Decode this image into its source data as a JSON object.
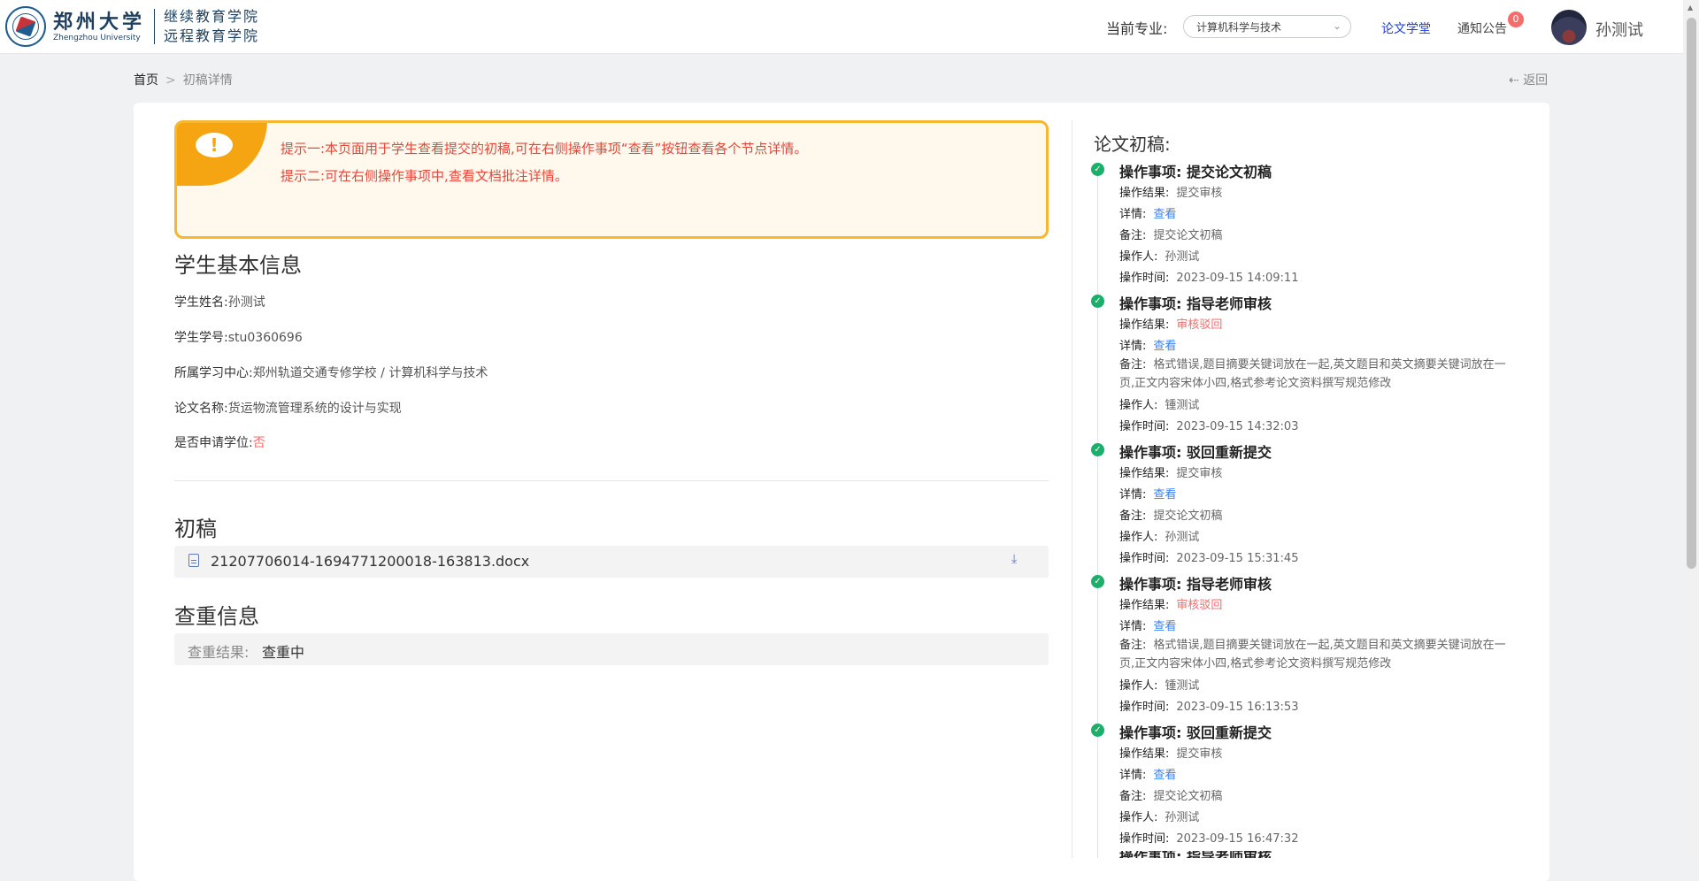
{
  "header": {
    "logo_cn": "郑州大学",
    "logo_en": "Zhengzhou University",
    "logo_sub1": "继续教育学院",
    "logo_sub2": "远程教育学院",
    "major_label": "当前专业:",
    "major_value": "计算机科学与技术",
    "nav_thesis": "论文学堂",
    "nav_notice": "通知公告",
    "notice_badge": "0",
    "username": "孙测试"
  },
  "breadcrumb": {
    "home": "首页",
    "sep": ">",
    "current": "初稿详情",
    "back": "返回"
  },
  "tip": {
    "line1": "提示一:本页面用于学生查看提交的初稿,可在右侧操作事项“查看”按钮查看各个节点详情。",
    "line2": "提示二:可在右侧操作事项中,查看文档批注详情。"
  },
  "student": {
    "title": "学生基本信息",
    "name_label": "学生姓名:",
    "name": "孙测试",
    "id_label": "学生学号:",
    "id": "stu0360696",
    "center_label": "所属学习中心:",
    "center": "郑州轨道交通专修学校 / 计算机科学与技术",
    "thesis_label": "论文名称:",
    "thesis": "货运物流管理系统的设计与实现",
    "degree_label": "是否申请学位:",
    "degree": "否"
  },
  "draft": {
    "title": "初稿",
    "file": "21207706014-1694771200018-163813.docx"
  },
  "dup": {
    "title": "查重信息",
    "label": "查重结果:",
    "value": "查重中"
  },
  "timeline": {
    "title": "论文初稿:",
    "k_item": "操作事项:",
    "k_result": "操作结果:",
    "k_detail": "详情:",
    "k_note": "备注:",
    "k_person": "操作人:",
    "k_time": "操作时间:",
    "view": "查看",
    "items": [
      {
        "item": "提交论文初稿",
        "result": "提交审核",
        "note": "提交论文初稿",
        "person": "孙测试",
        "time": "2023-09-15 14:09:11"
      },
      {
        "item": "指导老师审核",
        "result": "审核驳回",
        "note": "格式错误,题目摘要关键词放在一起,英文题目和英文摘要关键词放在一页,正文内容宋体小四,格式参考论文资料撰写规范修改",
        "person": "锺测试",
        "time": "2023-09-15 14:32:03"
      },
      {
        "item": "驳回重新提交",
        "result": "提交审核",
        "note": "提交论文初稿",
        "person": "孙测试",
        "time": "2023-09-15 15:31:45"
      },
      {
        "item": "指导老师审核",
        "result": "审核驳回",
        "note": "格式错误,题目摘要关键词放在一起,英文题目和英文摘要关键词放在一页,正文内容宋体小四,格式参考论文资料撰写规范修改",
        "person": "锺测试",
        "time": "2023-09-15 16:13:53"
      },
      {
        "item": "驳回重新提交",
        "result": "提交审核",
        "note": "提交论文初稿",
        "person": "孙测试",
        "time": "2023-09-15 16:47:32"
      }
    ],
    "partial_item": "操作事项:  指导老师审核"
  }
}
